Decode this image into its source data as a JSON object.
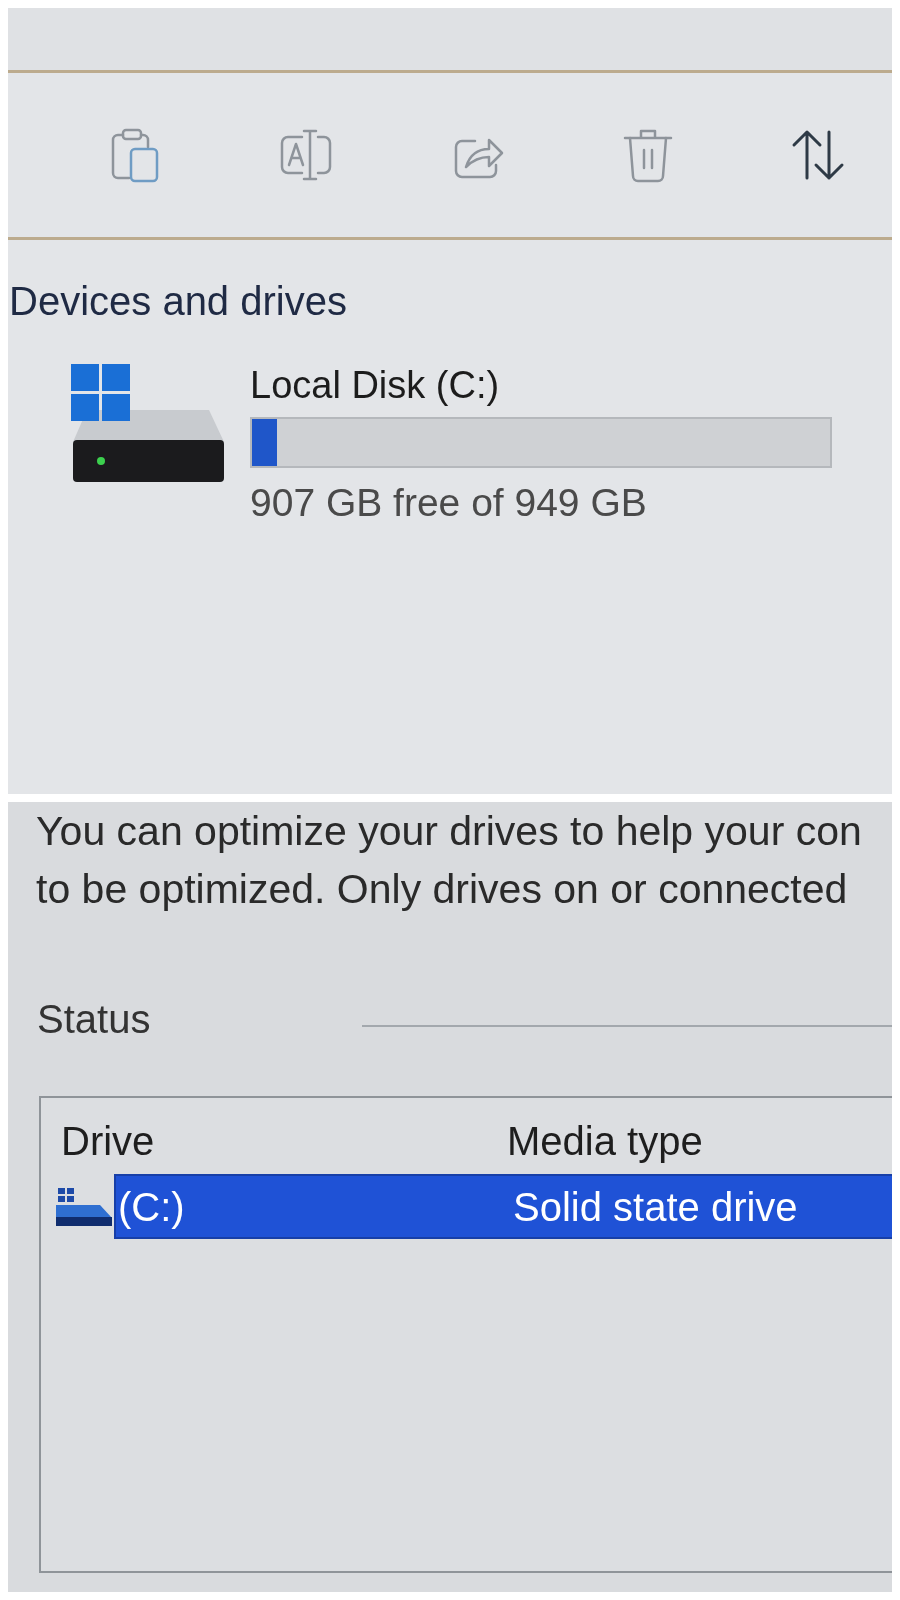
{
  "toolbar": {
    "buttons": [
      {
        "kind": "paste",
        "disabled": true
      },
      {
        "kind": "rename",
        "disabled": true
      },
      {
        "kind": "share",
        "disabled": true
      },
      {
        "kind": "delete",
        "disabled": true
      },
      {
        "kind": "sort",
        "disabled": false
      }
    ]
  },
  "devices_and_drives": {
    "heading": "Devices and drives",
    "drives": [
      {
        "name": "Local Disk (C:)",
        "level": 0.044,
        "free_text": "907 GB free of 949 GB"
      }
    ]
  },
  "optimize_drives": {
    "description": [
      "You can optimize your drives to help your con",
      "to be optimized. Only drives on or connected"
    ],
    "status_group": {
      "label": "Status"
    },
    "table": {
      "columns": [
        "Drive",
        "Media type"
      ],
      "rows": [
        {
          "cells": [
            "(C:)",
            "Solid state drive"
          ],
          "selected": true
        }
      ]
    }
  }
}
